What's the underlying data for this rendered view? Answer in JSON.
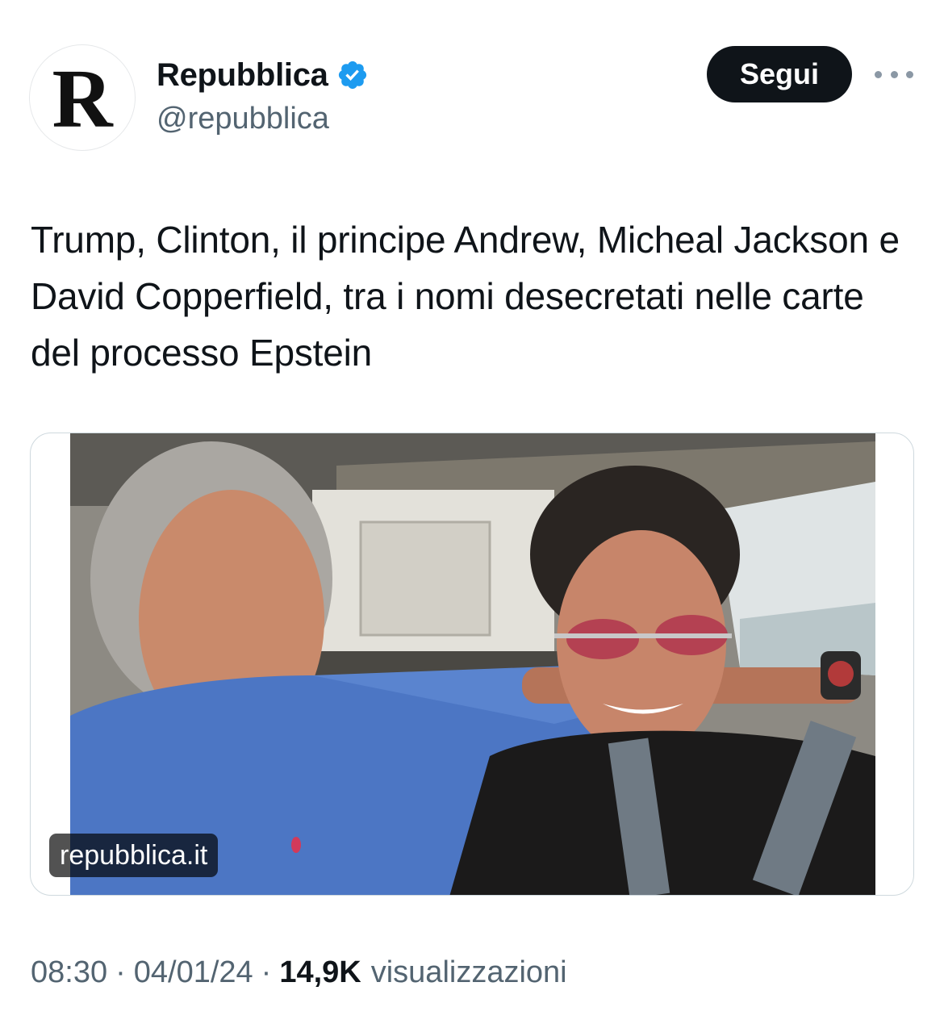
{
  "account": {
    "avatar_letter": "R",
    "display_name": "Repubblica",
    "handle": "@repubblica",
    "verified_icon": "verified-badge-icon",
    "verified_color": "#1d9bf0"
  },
  "actions": {
    "follow_label": "Segui",
    "more_icon": "more-options-icon"
  },
  "tweet": {
    "text": "Trump, Clinton, il principe Andrew, Micheal Jackson e David Copperfield, tra i nomi desecretati nelle carte del processo Epstein"
  },
  "media": {
    "link_label": "repubblica.it"
  },
  "meta": {
    "time": "08:30",
    "separator": "·",
    "date": "04/01/24",
    "views_count": "14,9K",
    "views_label": "visualizzazioni"
  },
  "colors": {
    "follow_bg": "#0f1419",
    "secondary_text": "#536471",
    "primary_text": "#0f1419"
  }
}
